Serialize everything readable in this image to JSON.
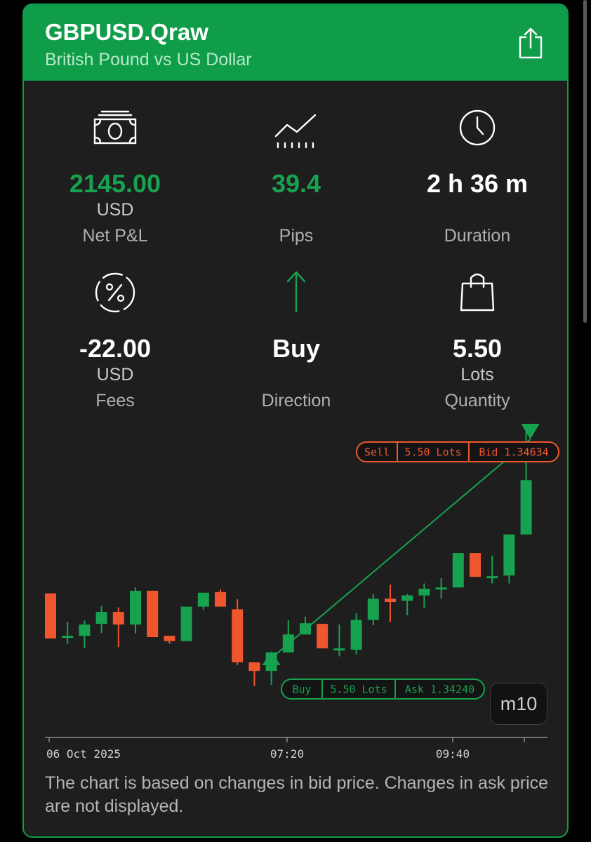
{
  "header": {
    "title": "GBPUSD.Qraw",
    "subtitle": "British Pound vs US Dollar",
    "share_icon": "share-icon"
  },
  "stats": {
    "net_pl": {
      "value": "2145.00",
      "unit": "USD",
      "label": "Net P&L",
      "icon": "banknote-icon"
    },
    "pips": {
      "value": "39.4",
      "label": "Pips",
      "icon": "trend-chart-icon"
    },
    "duration": {
      "value": "2 h 36 m",
      "label": "Duration",
      "icon": "clock-icon"
    },
    "fees": {
      "value": "-22.00",
      "unit": "USD",
      "label": "Fees",
      "icon": "percent-icon"
    },
    "direction": {
      "value": "Buy",
      "label": "Direction",
      "icon": "arrow-up-icon"
    },
    "quantity": {
      "value": "5.50",
      "unit": "Lots",
      "label": "Quantity",
      "icon": "shopping-bag-icon"
    }
  },
  "colors": {
    "brand": "#0f9d4a",
    "positive": "#17a24f",
    "bull_candle": "#17a24f",
    "bear_candle": "#f0562e"
  },
  "chart_data": {
    "type": "candlestick",
    "timeframe": "m10",
    "x_tick_labels": [
      "06 Oct 2025",
      "07:20",
      "09:40"
    ],
    "candles": [
      {
        "o": 1.34378,
        "h": 1.34378,
        "l": 1.3431,
        "c": 1.3431
      },
      {
        "o": 1.34312,
        "h": 1.34335,
        "l": 1.34302,
        "c": 1.34314
      },
      {
        "o": 1.34314,
        "h": 1.34337,
        "l": 1.34296,
        "c": 1.34331
      },
      {
        "o": 1.34332,
        "h": 1.34359,
        "l": 1.34318,
        "c": 1.3435
      },
      {
        "o": 1.3435,
        "h": 1.34357,
        "l": 1.34297,
        "c": 1.34331
      },
      {
        "o": 1.34331,
        "h": 1.34387,
        "l": 1.34318,
        "c": 1.34382
      },
      {
        "o": 1.34382,
        "h": 1.34382,
        "l": 1.34312,
        "c": 1.34312
      },
      {
        "o": 1.34314,
        "h": 1.34314,
        "l": 1.34302,
        "c": 1.34306
      },
      {
        "o": 1.34306,
        "h": 1.34358,
        "l": 1.34306,
        "c": 1.34358
      },
      {
        "o": 1.34358,
        "h": 1.34379,
        "l": 1.34353,
        "c": 1.34379
      },
      {
        "o": 1.3438,
        "h": 1.34384,
        "l": 1.34358,
        "c": 1.34358
      },
      {
        "o": 1.34354,
        "h": 1.34369,
        "l": 1.3427,
        "c": 1.34274
      },
      {
        "o": 1.34274,
        "h": 1.34274,
        "l": 1.34238,
        "c": 1.34261
      },
      {
        "o": 1.34261,
        "h": 1.34289,
        "l": 1.3424,
        "c": 1.34289
      },
      {
        "o": 1.34289,
        "h": 1.34338,
        "l": 1.34289,
        "c": 1.34316
      },
      {
        "o": 1.34316,
        "h": 1.34343,
        "l": 1.34316,
        "c": 1.34333
      },
      {
        "o": 1.34332,
        "h": 1.34332,
        "l": 1.34295,
        "c": 1.34295
      },
      {
        "o": 1.34295,
        "h": 1.34331,
        "l": 1.34283,
        "c": 1.34295
      },
      {
        "o": 1.34293,
        "h": 1.34348,
        "l": 1.34286,
        "c": 1.34338
      },
      {
        "o": 1.34338,
        "h": 1.34377,
        "l": 1.3433,
        "c": 1.3437
      },
      {
        "o": 1.3437,
        "h": 1.34391,
        "l": 1.34335,
        "c": 1.34365
      },
      {
        "o": 1.34367,
        "h": 1.34377,
        "l": 1.34345,
        "c": 1.34375
      },
      {
        "o": 1.34375,
        "h": 1.34393,
        "l": 1.34356,
        "c": 1.34385
      },
      {
        "o": 1.34387,
        "h": 1.34401,
        "l": 1.3437,
        "c": 1.34387
      },
      {
        "o": 1.34387,
        "h": 1.34439,
        "l": 1.34387,
        "c": 1.34439
      },
      {
        "o": 1.34439,
        "h": 1.34439,
        "l": 1.34403,
        "c": 1.34403
      },
      {
        "o": 1.34404,
        "h": 1.34435,
        "l": 1.34393,
        "c": 1.34404
      },
      {
        "o": 1.34405,
        "h": 1.34467,
        "l": 1.34393,
        "c": 1.34467
      },
      {
        "o": 1.34467,
        "h": 1.34634,
        "l": 1.34467,
        "c": 1.34549
      }
    ],
    "entry": {
      "side": "Buy",
      "lots": "5.50 Lots",
      "price_label": "Ask 1.34240",
      "price": 1.3424,
      "candle_index": 13
    },
    "exit": {
      "side": "Sell",
      "lots": "5.50 Lots",
      "price_label": "Bid 1.34634",
      "price": 1.34634,
      "candle_index": 28
    },
    "grid": false
  },
  "timeframe_button": "m10",
  "footnote": "The chart is based on changes in bid price. Changes in ask price are not displayed."
}
